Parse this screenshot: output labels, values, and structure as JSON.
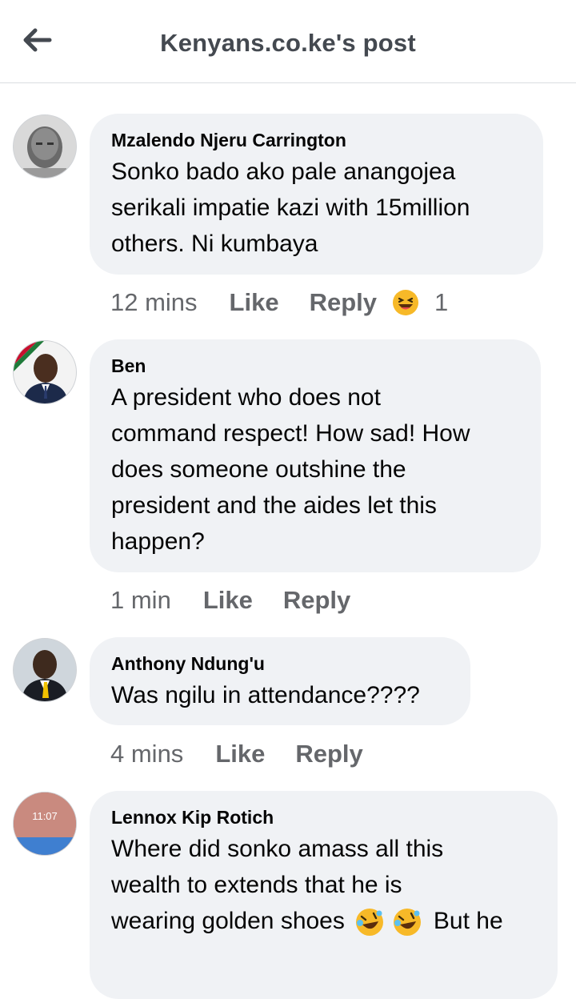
{
  "header": {
    "title": "Kenyans.co.ke's post",
    "back_icon": "arrow-left-icon"
  },
  "comments": [
    {
      "author": "Mzalendo Njeru Carrington",
      "lines": [
        "Sonko bado ako pale anangojea",
        "serikali impatie kazi with 15million",
        "others. Ni kumbaya"
      ],
      "time": "12 mins",
      "like": "Like",
      "reply": "Reply",
      "reaction_icon": "laughing-emoji-icon",
      "reaction_count": "1"
    },
    {
      "author": "Ben",
      "lines": [
        "A president who does not",
        "command respect! How sad! How",
        "does someone outshine the",
        "president and the aides let this",
        "happen?"
      ],
      "time": "1 min",
      "like": "Like",
      "reply": "Reply"
    },
    {
      "author": "Anthony Ndung'u",
      "lines": [
        "Was ngilu in attendance????"
      ],
      "time": "4 mins",
      "like": "Like",
      "reply": "Reply"
    },
    {
      "author": "Lennox Kip Rotich",
      "lines": [
        "Where did sonko amass all this",
        "wealth to extends that he is",
        "wearing golden shoes",
        "But he"
      ],
      "inline_emoji": "rolling-on-floor-laughing-emoji-icon",
      "avatar_time_text": "11:07"
    }
  ],
  "colors": {
    "bubble": "#f0f2f5",
    "meta_text": "#65676b",
    "title": "#444950"
  }
}
